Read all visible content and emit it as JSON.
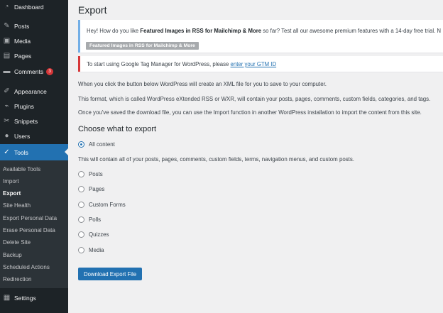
{
  "sidebar": {
    "items": [
      {
        "label": "Dashboard",
        "icon": "dashboard-icon"
      },
      {
        "label": "Posts",
        "icon": "pushpin-icon"
      },
      {
        "label": "Media",
        "icon": "media-icon"
      },
      {
        "label": "Pages",
        "icon": "pages-icon"
      },
      {
        "label": "Comments",
        "icon": "comments-icon",
        "badge": "3"
      },
      {
        "label": "Appearance",
        "icon": "paintbrush-icon"
      },
      {
        "label": "Plugins",
        "icon": "plugin-icon"
      },
      {
        "label": "Snippets",
        "icon": "scissors-icon"
      },
      {
        "label": "Users",
        "icon": "users-icon"
      },
      {
        "label": "Tools",
        "icon": "wrench-icon",
        "active": true
      },
      {
        "label": "Settings",
        "icon": "settings-icon"
      }
    ],
    "submenu": [
      "Available Tools",
      "Import",
      "Export",
      "Site Health",
      "Export Personal Data",
      "Erase Personal Data",
      "Delete Site",
      "Backup",
      "Scheduled Actions",
      "Redirection"
    ],
    "current_submenu": "Export"
  },
  "main": {
    "title": "Export",
    "notice_info": {
      "prefix": "Hey! How do you like ",
      "bold": "Featured Images in RSS for Mailchimp & More",
      "suffix": " so far? Test all our awesome premium features with a 14-day free trial. N",
      "button": "Featured Images in RSS for Mailchimp & More"
    },
    "notice_error": {
      "text": "To start using Google Tag Manager for WordPress, please ",
      "link": "enter your GTM ID"
    },
    "paragraphs": [
      "When you click the button below WordPress will create an XML file for you to save to your computer.",
      "This format, which is called WordPress eXtended RSS or WXR, will contain your posts, pages, comments, custom fields, categories, and tags.",
      "Once you've saved the download file, you can use the Import function in another WordPress installation to import the content from this site."
    ],
    "choose_title": "Choose what to export",
    "all_content": "All content",
    "all_content_desc": "This will contain all of your posts, pages, comments, custom fields, terms, navigation menus, and custom posts.",
    "options": [
      "Posts",
      "Pages",
      "Custom Forms",
      "Polls",
      "Quizzes",
      "Media"
    ],
    "download_button": "Download Export File"
  },
  "colors": {
    "accent": "#2271b1",
    "sidebar_bg": "#1d2327",
    "error": "#d63638",
    "info": "#72aee6"
  }
}
